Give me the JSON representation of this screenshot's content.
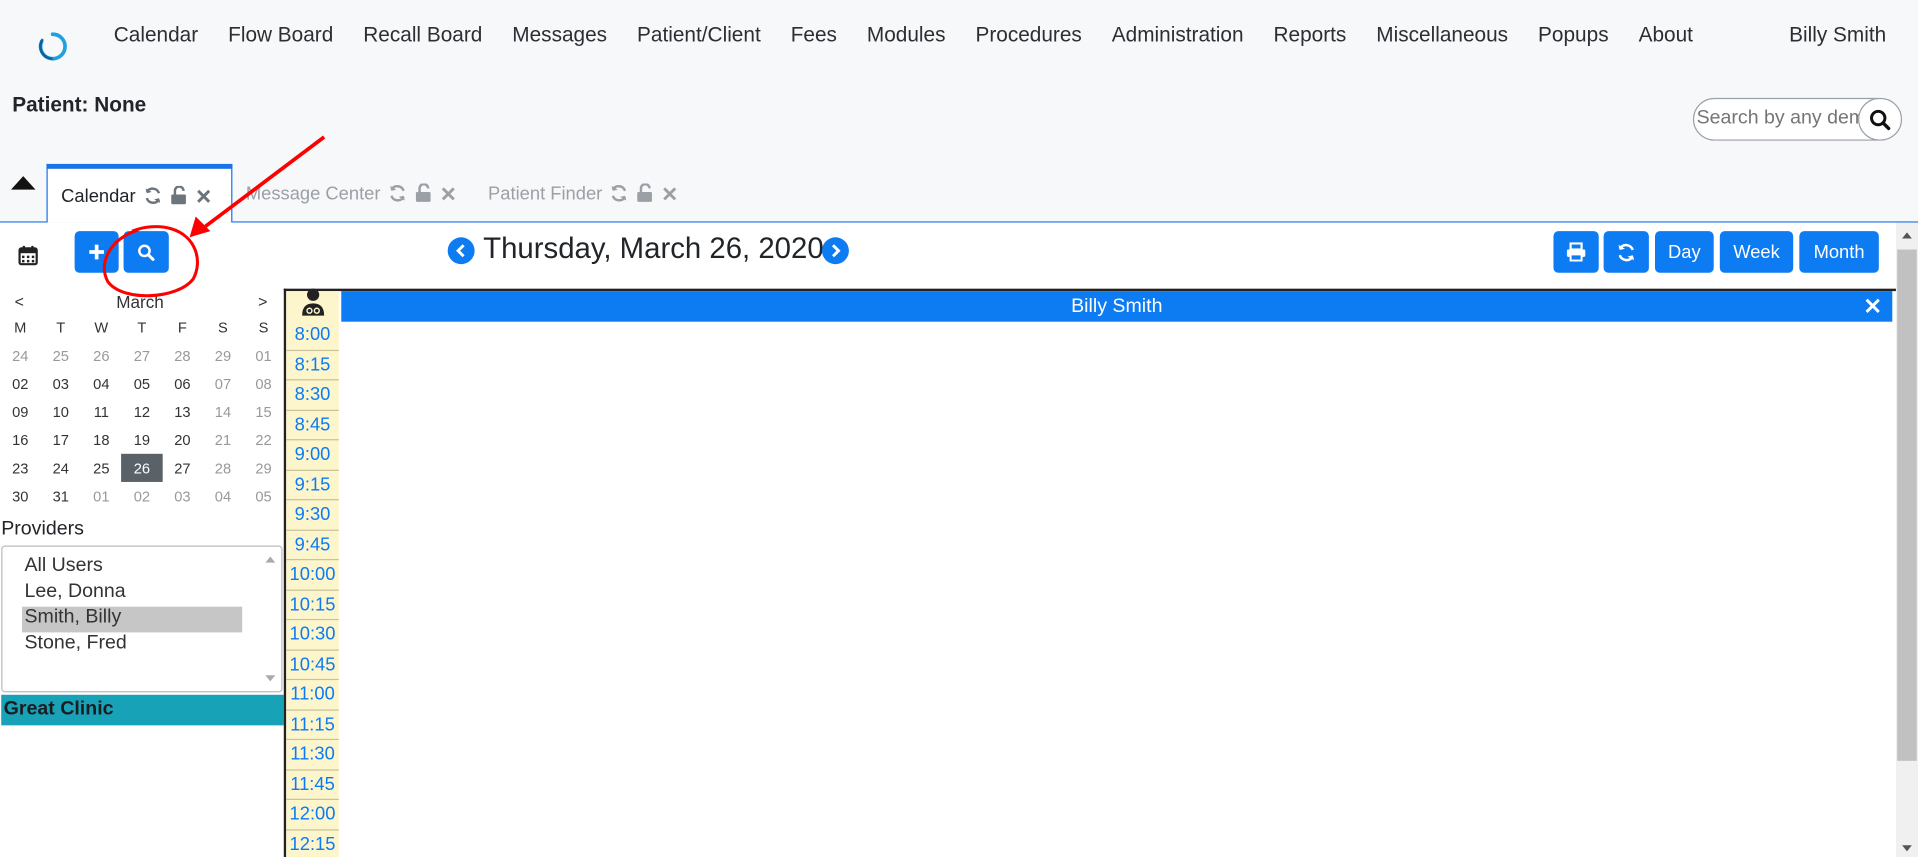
{
  "nav": {
    "items": [
      "Calendar",
      "Flow Board",
      "Recall Board",
      "Messages",
      "Patient/Client",
      "Fees",
      "Modules",
      "Procedures",
      "Administration",
      "Reports",
      "Miscellaneous",
      "Popups",
      "About"
    ],
    "user": "Billy Smith"
  },
  "patient_label": "Patient: None",
  "search": {
    "placeholder": "Search by any demographics"
  },
  "tabs": [
    {
      "label": "Calendar",
      "active": true
    },
    {
      "label": "Message Center",
      "active": false
    },
    {
      "label": "Patient Finder",
      "active": false
    }
  ],
  "toolbar": {
    "date_title": "Thursday, March 26, 2020",
    "view_buttons": [
      "Day",
      "Week",
      "Month"
    ]
  },
  "mini_calendar": {
    "month": "March",
    "prev": "<",
    "next": ">",
    "weekdays": [
      "M",
      "T",
      "W",
      "T",
      "F",
      "S",
      "S"
    ],
    "weeks": [
      [
        "24",
        "25",
        "26",
        "27",
        "28",
        "29",
        "01"
      ],
      [
        "02",
        "03",
        "04",
        "05",
        "06",
        "07",
        "08"
      ],
      [
        "09",
        "10",
        "11",
        "12",
        "13",
        "14",
        "15"
      ],
      [
        "16",
        "17",
        "18",
        "19",
        "20",
        "21",
        "22"
      ],
      [
        "23",
        "24",
        "25",
        "26",
        "27",
        "28",
        "29"
      ],
      [
        "30",
        "31",
        "01",
        "02",
        "03",
        "04",
        "05"
      ]
    ],
    "selected": "26"
  },
  "providers": {
    "label": "Providers",
    "options": [
      "All Users",
      "Lee, Donna",
      "Smith, Billy",
      "Stone, Fred"
    ],
    "selected": "Smith, Billy"
  },
  "facility": "Great Clinic",
  "schedule": {
    "provider": "Billy Smith",
    "times": [
      "8:00",
      "8:15",
      "8:30",
      "8:45",
      "9:00",
      "9:15",
      "9:30",
      "9:45",
      "10:00",
      "10:15",
      "10:30",
      "10:45",
      "11:00",
      "11:15",
      "11:30",
      "11:45",
      "12:00",
      "12:15"
    ]
  },
  "colors": {
    "accent": "#0d7bf2",
    "facility": "#17a2b8",
    "time_bg": "#fdf6cc",
    "annotation": "#ff0000"
  },
  "icons": [
    "app-logo-icon",
    "refresh-icon",
    "unlock-icon",
    "close-icon",
    "calendar-icon",
    "plus-icon",
    "search-icon",
    "chevron-left-icon",
    "chevron-right-icon",
    "print-icon",
    "provider-icon"
  ]
}
